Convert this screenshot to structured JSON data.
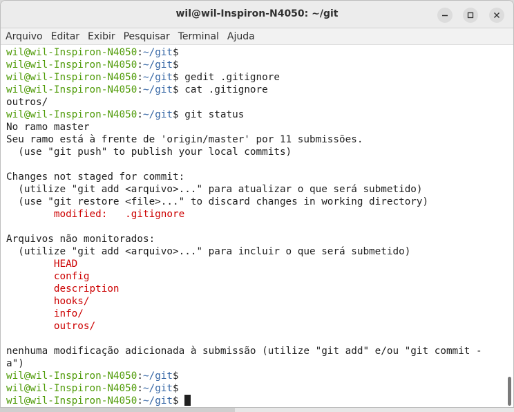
{
  "window": {
    "title": "wil@wil-Inspiron-N4050: ~/git",
    "buttons": {
      "minimize": "minimize-icon",
      "maximize": "maximize-icon",
      "close": "close-icon"
    }
  },
  "menu": [
    "Arquivo",
    "Editar",
    "Exibir",
    "Pesquisar",
    "Terminal",
    "Ajuda"
  ],
  "colors": {
    "user": "#4e9a06",
    "path": "#3465a4",
    "highlight": "#cc0000",
    "text": "#202020"
  },
  "terminal": {
    "lines": [
      {
        "t": "prompt",
        "user": "wil@wil-Inspiron-N4050",
        "path": "~/git",
        "cmd": ""
      },
      {
        "t": "prompt",
        "user": "wil@wil-Inspiron-N4050",
        "path": "~/git",
        "cmd": ""
      },
      {
        "t": "prompt",
        "user": "wil@wil-Inspiron-N4050",
        "path": "~/git",
        "cmd": " gedit .gitignore"
      },
      {
        "t": "prompt",
        "user": "wil@wil-Inspiron-N4050",
        "path": "~/git",
        "cmd": " cat .gitignore"
      },
      {
        "t": "out",
        "text": "outros/"
      },
      {
        "t": "prompt",
        "user": "wil@wil-Inspiron-N4050",
        "path": "~/git",
        "cmd": " git status"
      },
      {
        "t": "out",
        "text": "No ramo master"
      },
      {
        "t": "out",
        "text": "Seu ramo está à frente de 'origin/master' por 11 submissões."
      },
      {
        "t": "out",
        "text": "  (use \"git push\" to publish your local commits)"
      },
      {
        "t": "out",
        "text": ""
      },
      {
        "t": "out",
        "text": "Changes not staged for commit:"
      },
      {
        "t": "out",
        "text": "  (utilize \"git add <arquivo>...\" para atualizar o que será submetido)"
      },
      {
        "t": "out",
        "text": "  (use \"git restore <file>...\" to discard changes in working directory)"
      },
      {
        "t": "red",
        "text": "        modified:   .gitignore"
      },
      {
        "t": "out",
        "text": ""
      },
      {
        "t": "out",
        "text": "Arquivos não monitorados:"
      },
      {
        "t": "out",
        "text": "  (utilize \"git add <arquivo>...\" para incluir o que será submetido)"
      },
      {
        "t": "red",
        "text": "        HEAD"
      },
      {
        "t": "red",
        "text": "        config"
      },
      {
        "t": "red",
        "text": "        description"
      },
      {
        "t": "red",
        "text": "        hooks/"
      },
      {
        "t": "red",
        "text": "        info/"
      },
      {
        "t": "red",
        "text": "        outros/"
      },
      {
        "t": "out",
        "text": ""
      },
      {
        "t": "out",
        "text": "nenhuma modificação adicionada à submissão (utilize \"git add\" e/ou \"git commit -"
      },
      {
        "t": "out",
        "text": "a\")"
      },
      {
        "t": "prompt",
        "user": "wil@wil-Inspiron-N4050",
        "path": "~/git",
        "cmd": ""
      },
      {
        "t": "prompt",
        "user": "wil@wil-Inspiron-N4050",
        "path": "~/git",
        "cmd": ""
      },
      {
        "t": "prompt",
        "user": "wil@wil-Inspiron-N4050",
        "path": "~/git",
        "cmd": " ",
        "cursor": true
      }
    ]
  }
}
